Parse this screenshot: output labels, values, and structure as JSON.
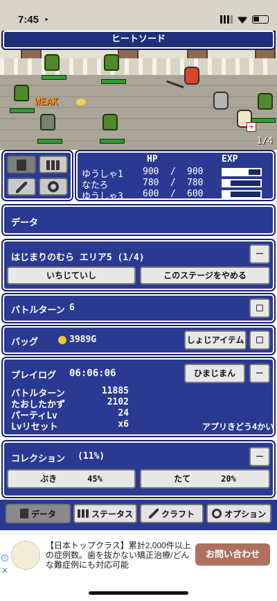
{
  "status_bar": {
    "time": "7:45"
  },
  "game": {
    "title": "ヒートソード",
    "weak_label": "WEAK",
    "page_indicator": "1/4"
  },
  "party": {
    "hp_header": "HP",
    "exp_header": "EXP",
    "members": [
      {
        "name": "ゆうしゃ1",
        "hp": "900",
        "sep": "/",
        "max": "900",
        "exp_fraction": 0.68
      },
      {
        "name": "なたろ",
        "hp": "780",
        "sep": "/",
        "max": "780",
        "exp_fraction": 0.2
      },
      {
        "name": "ゆうしゃ3",
        "hp": "600",
        "sep": "/",
        "max": "600",
        "exp_fraction": 0.2
      }
    ]
  },
  "data_header": "データ",
  "stage": {
    "title": "はじまりのむら エリア5 (1/4)",
    "collapse": "—",
    "fixed_btn": "いちじていし",
    "quit_btn": "このステージをやめる"
  },
  "battle_turn": {
    "label": "バトルターン",
    "value": "6",
    "box": "□"
  },
  "bag": {
    "label": "バッグ",
    "gold": "3989G",
    "items_btn": "しょじアイテム",
    "box": "□"
  },
  "playlog": {
    "label": "プレイログ",
    "time": "06:06:06",
    "more_btn": "ひまじまん",
    "collapse": "—",
    "stats": [
      {
        "k": "バトルターン",
        "v": "11885"
      },
      {
        "k": "たおしたかず",
        "v": "2102"
      },
      {
        "k": "パーティLv",
        "v": "24"
      },
      {
        "k": "Lvリセット",
        "v": "x6"
      }
    ],
    "app_launch": "アプリきどう4かい"
  },
  "collection": {
    "label": "コレクション",
    "pct": "(11%)",
    "collapse": "—",
    "items": [
      {
        "k": "ぶき",
        "v": "45%"
      },
      {
        "k": "たて",
        "v": "20%"
      }
    ]
  },
  "nav": {
    "tabs": [
      {
        "label": "データ",
        "icon": "document-icon",
        "selected": true
      },
      {
        "label": "ステータス",
        "icon": "party-icon",
        "selected": false
      },
      {
        "label": "クラフト",
        "icon": "hammer-icon",
        "selected": false
      },
      {
        "label": "オプション",
        "icon": "gear-icon",
        "selected": false
      }
    ]
  },
  "ad": {
    "text": "【日本トップクラス】累計2,000件以上の症例数。歯を抜かない矯正治療/どんな難症例にも対応可能",
    "cta": "お問い合わせ"
  },
  "colors": {
    "panel": "#2a3a92",
    "panel_border": "#ffffff",
    "hp_green": "#2aa12a",
    "weak_orange": "#f08a1c",
    "cta": "#b07060"
  }
}
